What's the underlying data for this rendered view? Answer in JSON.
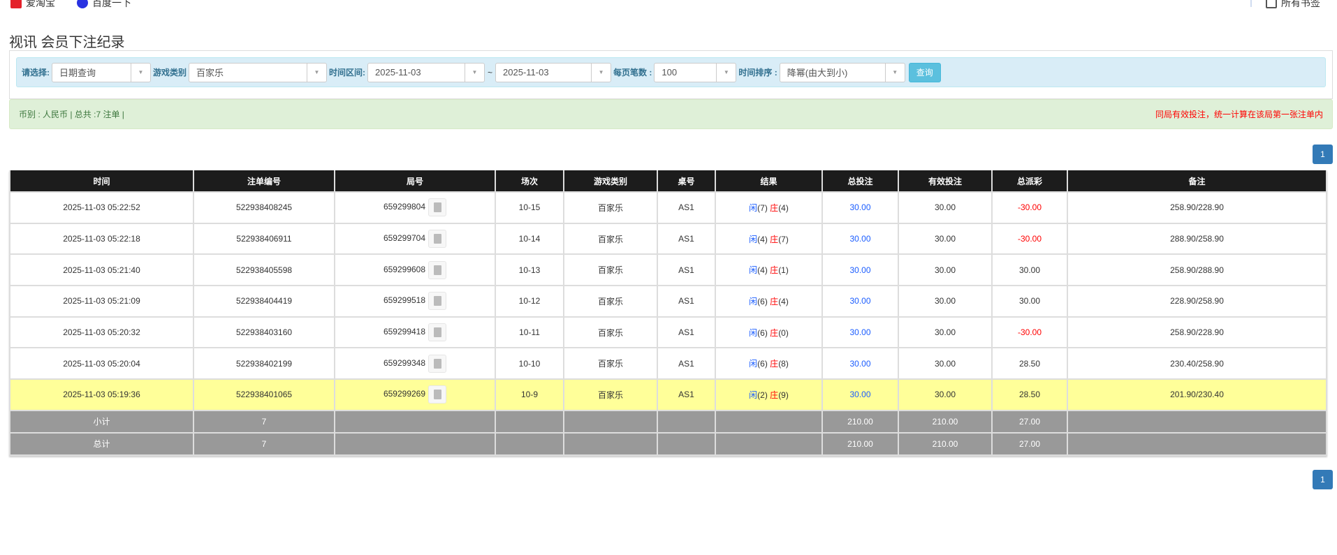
{
  "bookmarks": {
    "items": [
      "爱淘宝",
      "百度一下"
    ],
    "all": "所有书签"
  },
  "page_title": "视讯 会员下注纪录",
  "filter": {
    "select_label": "请选择:",
    "select_value": "日期查询",
    "game_label": "游戏类别",
    "game_value": "百家乐",
    "range_label": "时间区间:",
    "from": "2025-11-03",
    "sep": "~",
    "to": "2025-11-03",
    "per_page_label": "每页笔数 :",
    "per_page": "100",
    "sort_label": "时间排序 :",
    "sort_value": "降幂(由大到小)",
    "query_button": "查询"
  },
  "alert": {
    "summary": "币别 : 人民币 | 总共 :7 注单 |",
    "note": "同局有效投注，统一计算在该局第一张注单内"
  },
  "pagination": {
    "current": "1"
  },
  "colors": {
    "header": "#1c1c1c",
    "highlight": "#ffff99",
    "summary": "#999999",
    "blue": "#1a5cff",
    "red": "#ff0000"
  },
  "table": {
    "headers": [
      "时间",
      "注单编号",
      "局号",
      "场次",
      "游戏类别",
      "桌号",
      "结果",
      "总投注",
      "有效投注",
      "总派彩",
      "备注"
    ],
    "rows": [
      {
        "time": "2025-11-03 05:22:52",
        "bet_id": "522938408245",
        "round": "659299804",
        "shoe": "10-15",
        "game": "百家乐",
        "table": "AS1",
        "p": "闲",
        "pv": "(7)",
        "b": "庄",
        "bv": "(4)",
        "total": "30.00",
        "valid": "30.00",
        "payout": "-30.00",
        "note": "258.90/228.90",
        "neg": true
      },
      {
        "time": "2025-11-03 05:22:18",
        "bet_id": "522938406911",
        "round": "659299704",
        "shoe": "10-14",
        "game": "百家乐",
        "table": "AS1",
        "p": "闲",
        "pv": "(4)",
        "b": "庄",
        "bv": "(7)",
        "total": "30.00",
        "valid": "30.00",
        "payout": "-30.00",
        "note": "288.90/258.90",
        "neg": true
      },
      {
        "time": "2025-11-03 05:21:40",
        "bet_id": "522938405598",
        "round": "659299608",
        "shoe": "10-13",
        "game": "百家乐",
        "table": "AS1",
        "p": "闲",
        "pv": "(4)",
        "b": "庄",
        "bv": "(1)",
        "total": "30.00",
        "valid": "30.00",
        "payout": "30.00",
        "note": "258.90/288.90",
        "neg": false
      },
      {
        "time": "2025-11-03 05:21:09",
        "bet_id": "522938404419",
        "round": "659299518",
        "shoe": "10-12",
        "game": "百家乐",
        "table": "AS1",
        "p": "闲",
        "pv": "(6)",
        "b": "庄",
        "bv": "(4)",
        "total": "30.00",
        "valid": "30.00",
        "payout": "30.00",
        "note": "228.90/258.90",
        "neg": false
      },
      {
        "time": "2025-11-03 05:20:32",
        "bet_id": "522938403160",
        "round": "659299418",
        "shoe": "10-11",
        "game": "百家乐",
        "table": "AS1",
        "p": "闲",
        "pv": "(6)",
        "b": "庄",
        "bv": "(0)",
        "total": "30.00",
        "valid": "30.00",
        "payout": "-30.00",
        "note": "258.90/228.90",
        "neg": true
      },
      {
        "time": "2025-11-03 05:20:04",
        "bet_id": "522938402199",
        "round": "659299348",
        "shoe": "10-10",
        "game": "百家乐",
        "table": "AS1",
        "p": "闲",
        "pv": "(6)",
        "b": "庄",
        "bv": "(8)",
        "total": "30.00",
        "valid": "30.00",
        "payout": "28.50",
        "note": "230.40/258.90",
        "neg": false
      },
      {
        "time": "2025-11-03 05:19:36",
        "bet_id": "522938401065",
        "round": "659299269",
        "shoe": "10-9",
        "game": "百家乐",
        "table": "AS1",
        "p": "闲",
        "pv": "(2)",
        "b": "庄",
        "bv": "(9)",
        "total": "30.00",
        "valid": "30.00",
        "payout": "28.50",
        "note": "201.90/230.40",
        "neg": false,
        "highlight": true
      }
    ],
    "subtotal": {
      "label": "小计",
      "count": "7",
      "total": "210.00",
      "valid": "210.00",
      "payout": "27.00"
    },
    "grand_total": {
      "label": "总计",
      "count": "7",
      "total": "210.00",
      "valid": "210.00",
      "payout": "27.00"
    }
  }
}
